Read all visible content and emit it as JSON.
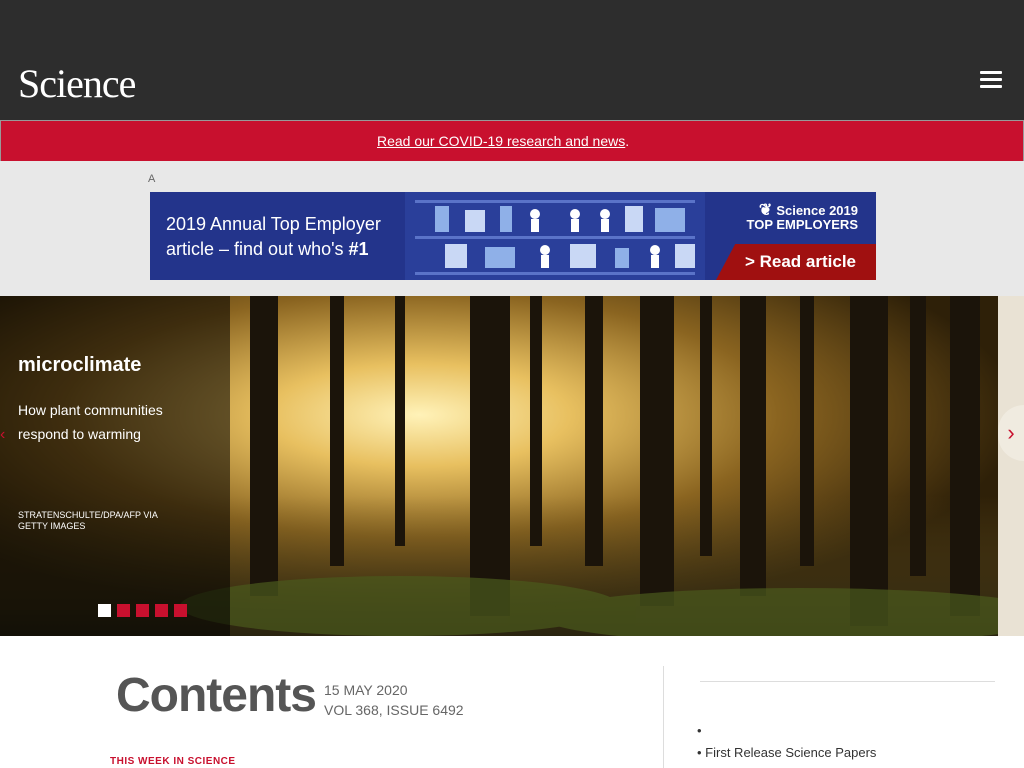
{
  "header": {
    "logo": "Science",
    "utility_link": "",
    "menu_icon": "hamburger-icon"
  },
  "banner": {
    "covid_text": "Read our COVID-19 research and news",
    "covid_link_suffix": "."
  },
  "ad": {
    "label": "A",
    "title_line1": "2019 Annual Top Employer",
    "title_line2_prefix": "article – find out who's ",
    "title_line2_bold": "#1",
    "brand_line1": "Science 2019",
    "brand_line2": "TOP EMPLOYERS",
    "cta": "> Read article"
  },
  "hero": {
    "kicker": "",
    "title": "microclimate",
    "description": "How plant communities respond to warming",
    "credit": "STRATENSCHULTE/DPA/AFP VIA GETTY IMAGES",
    "next_icon": "chevron-right-icon",
    "prev_icon": "chevron-left-icon",
    "dot_count": 5,
    "active_dot": 0
  },
  "contents": {
    "title": "Contents",
    "date": "15 MAY 2020",
    "volume": "VOL 368, ISSUE 6492",
    "section_label": "THIS WEEK IN SCIENCE"
  },
  "sidebar": {
    "heading": "",
    "items": [
      "",
      "First Release Science Papers"
    ]
  },
  "colors": {
    "brand_red": "#c8102e",
    "dark_bar": "#2d2d2d",
    "ad_blue": "#23348b"
  }
}
